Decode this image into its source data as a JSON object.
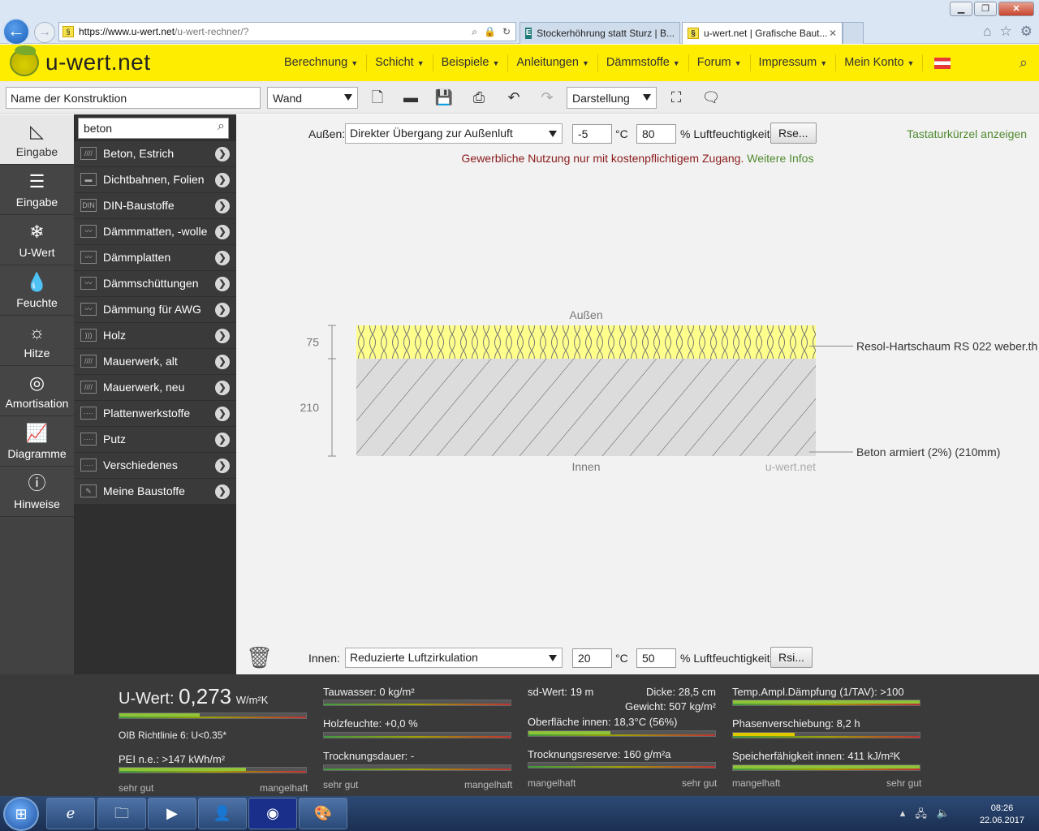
{
  "browser": {
    "url_host": "https://www.u-wert.net",
    "url_path": "/u-wert-rechner/?",
    "tabs": [
      {
        "label": "Stockerhöhrung statt Sturz | B...",
        "active": false
      },
      {
        "label": "u-wert.net | Grafische Baut...",
        "active": true
      }
    ],
    "tab_close": "✕"
  },
  "header": {
    "logo_text": "u-wert.net",
    "nav": [
      "Berechnung",
      "Schicht",
      "Beispiele",
      "Anleitungen",
      "Dämmstoffe",
      "Forum",
      "Impressum",
      "Mein Konto"
    ],
    "flag": "Austria"
  },
  "toolbar": {
    "construction_name": "Name der Konstruktion",
    "type_select": "Wand",
    "view_select": "Darstellung"
  },
  "leftnav": [
    {
      "label": "Eingabe",
      "icon": "ruler-triangle-icon",
      "glyph": "◺",
      "active": true
    },
    {
      "label": "Eingabe",
      "icon": "layers-edit-icon",
      "glyph": "☰",
      "active": false
    },
    {
      "label": "U-Wert",
      "icon": "thermometer-snow-icon",
      "glyph": "❄",
      "active": false
    },
    {
      "label": "Feuchte",
      "icon": "drop-icon",
      "glyph": "💧",
      "active": false
    },
    {
      "label": "Hitze",
      "icon": "sun-icon",
      "glyph": "☼",
      "active": false
    },
    {
      "label": "Amortisation",
      "icon": "coins-icon",
      "glyph": "◎",
      "active": false
    },
    {
      "label": "Diagramme",
      "icon": "chart-icon",
      "glyph": "📈",
      "active": false
    },
    {
      "label": "Hinweise",
      "icon": "alert-icon",
      "glyph": "ⓘ",
      "active": false
    }
  ],
  "materials": {
    "search_value": "beton",
    "items": [
      {
        "label": "Beton, Estrich",
        "icon": "hatch-icon",
        "glyph": "////"
      },
      {
        "label": "Dichtbahnen, Folien",
        "icon": "membrane-icon",
        "glyph": "▬"
      },
      {
        "label": "DIN-Baustoffe",
        "icon": "din-icon",
        "glyph": "DIN"
      },
      {
        "label": "Dämmmatten, -wolle",
        "icon": "insulation-icon",
        "glyph": "〰"
      },
      {
        "label": "Dämmplatten",
        "icon": "insulation-icon",
        "glyph": "〰"
      },
      {
        "label": "Dämmschüttungen",
        "icon": "insulation-icon",
        "glyph": "〰"
      },
      {
        "label": "Dämmung für AWG",
        "icon": "insulation-icon",
        "glyph": "〰"
      },
      {
        "label": "Holz",
        "icon": "wood-icon",
        "glyph": ")))"
      },
      {
        "label": "Mauerwerk, alt",
        "icon": "hatch-icon",
        "glyph": "////"
      },
      {
        "label": "Mauerwerk, neu",
        "icon": "hatch-icon",
        "glyph": "////"
      },
      {
        "label": "Plattenwerkstoffe",
        "icon": "board-icon",
        "glyph": "····"
      },
      {
        "label": "Putz",
        "icon": "plaster-icon",
        "glyph": "····"
      },
      {
        "label": "Verschiedenes",
        "icon": "misc-icon",
        "glyph": "····"
      },
      {
        "label": "Meine Baustoffe",
        "icon": "pencil-icon",
        "glyph": "✎"
      }
    ]
  },
  "outer": {
    "label": "Außen:",
    "select": "Direkter Übergang zur Außenluft",
    "temp": "-5",
    "temp_unit": "°C",
    "humidity": "80",
    "humidity_label": "% Luftfeuchtigkeit",
    "rse_button": "Rse..."
  },
  "inner": {
    "label": "Innen:",
    "select": "Reduzierte Luftzirkulation",
    "temp": "20",
    "temp_unit": "°C",
    "humidity": "50",
    "humidity_label": "% Luftfeuchtigkeit",
    "rsi_button": "Rsi..."
  },
  "shortcut_link": "Tastaturkürzel anzeigen",
  "notice": {
    "text": "Gewerbliche Nutzung nur mit kostenpflichtigem Zugang.",
    "link": "Weitere Infos"
  },
  "drawing": {
    "top_label": "Außen",
    "bottom_label": "Innen",
    "watermark": "u-wert.net",
    "layers": [
      {
        "thickness_label": "75",
        "name": "Resol-Hartschaum RS 022 weber.th",
        "color": "#ffff8c"
      },
      {
        "thickness_label": "210",
        "name": "Beton armiert (2%) (210mm)",
        "color": "#dcdcdc"
      }
    ]
  },
  "stats": {
    "u_label": "U-Wert:",
    "u_value": "0,273",
    "u_unit": "W/m²K",
    "oib": "OIB Richtlinie 6: U<0.35*",
    "pei": "PEI n.e.: >147 kWh/m²",
    "scale_good": "sehr gut",
    "scale_bad": "mangelhaft",
    "tauwasser": "Tauwasser: 0 kg/m²",
    "holzfeuchte": "Holzfeuchte: +0,0 %",
    "trocknungsdauer": "Trocknungsdauer: -",
    "sd": "sd-Wert: 19 m",
    "dicke": "Dicke: 28,5 cm",
    "gewicht": "Gewicht: 507 kg/m²",
    "oberflaeche": "Oberfläche innen: 18,3°C (56%)",
    "trocknungsreserve": "Trocknungsreserve: 160 g/m²a",
    "tav": "Temp.Ampl.Dämpfung (1/TAV): >100",
    "phase": "Phasenverschiebung: 8,2 h",
    "speicher": "Speicherfähigkeit innen: 411 kJ/m²K",
    "levels": {
      "u_wert": 0.43,
      "pei": 0.68,
      "oberflaeche": 0.44,
      "tav": 1.0,
      "phase": 0.33,
      "speicher": 1.0
    },
    "colors": {
      "good": "#8fc43a",
      "mid": "#e0c800"
    }
  },
  "taskbar": {
    "time": "08:26",
    "date": "22.06.2017"
  }
}
